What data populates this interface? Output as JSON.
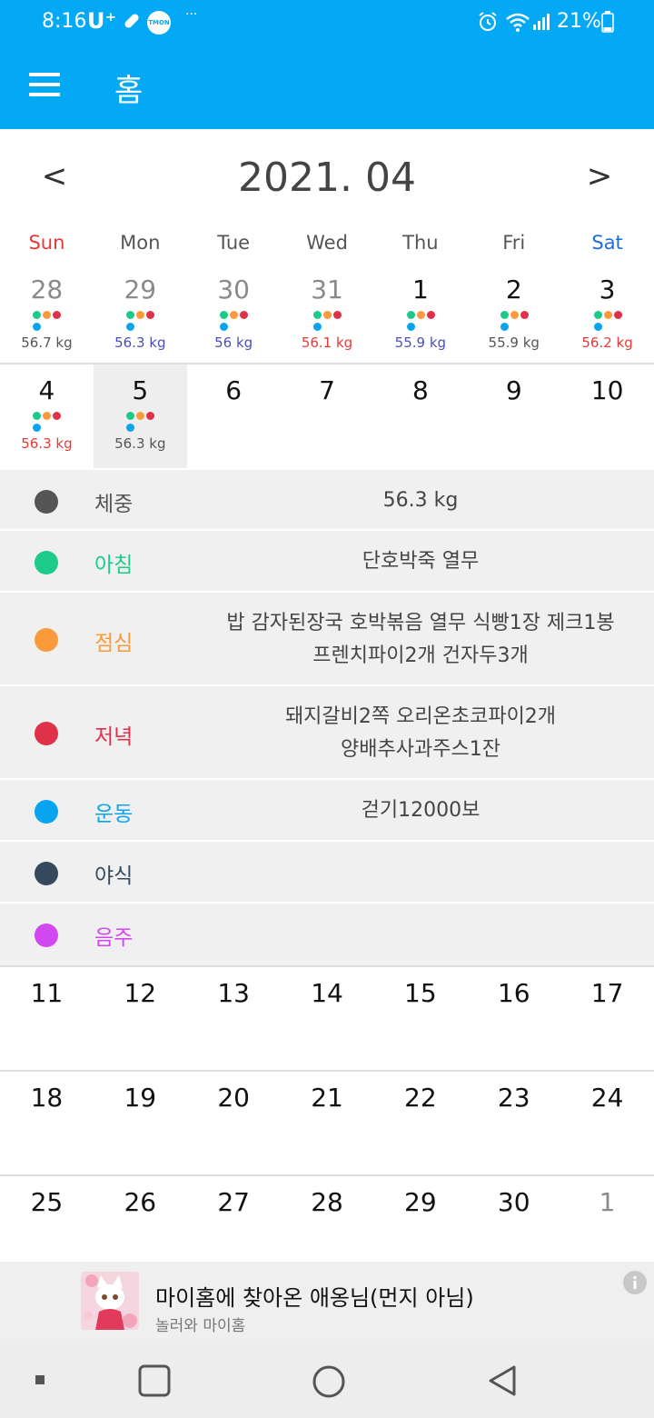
{
  "status_bar": {
    "time": "8:16",
    "carrier": "U⁺",
    "app_badge": "TMON",
    "overflow": "···",
    "battery": "21%",
    "icons": [
      "pill-icon",
      "tmon-icon",
      "alarm-icon",
      "wifi-icon",
      "signal-icon",
      "battery-icon"
    ]
  },
  "app_bar": {
    "title": "홈",
    "menu_icon": "menu-icon",
    "color": "#03a9f4"
  },
  "calendar": {
    "month_title": "2021. 04",
    "prev": "<",
    "next": ">",
    "weekdays": [
      "Sun",
      "Mon",
      "Tue",
      "Wed",
      "Thu",
      "Fri",
      "Sat"
    ],
    "weeks": [
      [
        {
          "day": "28",
          "weight": "56.7 kg",
          "muted": true
        },
        {
          "day": "29",
          "weight": "56.3 kg",
          "muted": true
        },
        {
          "day": "30",
          "weight": "56 kg",
          "muted": true
        },
        {
          "day": "31",
          "weight": "56.1 kg",
          "muted": true
        },
        {
          "day": "1",
          "weight": "55.9 kg"
        },
        {
          "day": "2",
          "weight": "55.9 kg"
        },
        {
          "day": "3",
          "weight": "56.2 kg"
        }
      ],
      [
        {
          "day": "4",
          "weight": "56.3 kg"
        },
        {
          "day": "5",
          "weight": "56.3 kg",
          "selected": true
        },
        {
          "day": "6"
        },
        {
          "day": "7"
        },
        {
          "day": "8"
        },
        {
          "day": "9"
        },
        {
          "day": "10"
        }
      ],
      [
        {
          "day": "11"
        },
        {
          "day": "12"
        },
        {
          "day": "13"
        },
        {
          "day": "14"
        },
        {
          "day": "15"
        },
        {
          "day": "16"
        },
        {
          "day": "17"
        }
      ],
      [
        {
          "day": "18"
        },
        {
          "day": "19"
        },
        {
          "day": "20"
        },
        {
          "day": "21"
        },
        {
          "day": "22"
        },
        {
          "day": "23"
        },
        {
          "day": "24"
        }
      ],
      [
        {
          "day": "25"
        },
        {
          "day": "26"
        },
        {
          "day": "27"
        },
        {
          "day": "28"
        },
        {
          "day": "29"
        },
        {
          "day": "30"
        },
        {
          "day": "1",
          "muted": true
        }
      ]
    ],
    "weight_colors": {
      "up": "#e53935",
      "down": "#4a4fb7",
      "same": "#555555"
    },
    "dot_colors": [
      "#1ccb8a",
      "#fb9a3a",
      "#e0314b",
      "#09a4f0"
    ]
  },
  "detail": {
    "rows": [
      {
        "label": "체중",
        "value": [
          "56.3 kg"
        ],
        "color": "#555555",
        "text_color": "#555555"
      },
      {
        "label": "아침",
        "value": [
          "단호박죽 열무"
        ],
        "color": "#1ccb8a",
        "text_color": "#1ccb8a"
      },
      {
        "label": "점심",
        "value": [
          "밥 감자된장국 호박볶음 열무 식빵1장 제크1봉",
          "프렌치파이2개 건자두3개"
        ],
        "color": "#fb9a3a",
        "text_color": "#fb9a3a"
      },
      {
        "label": "저녁",
        "value": [
          "돼지갈비2쪽 오리온초코파이2개",
          "양배추사과주스1잔"
        ],
        "color": "#e0314b",
        "text_color": "#e0314b"
      },
      {
        "label": "운동",
        "value": [
          "걷기12000보"
        ],
        "color": "#09a4f0",
        "text_color": "#09a4f0"
      },
      {
        "label": "야식",
        "value": [],
        "color": "#34495e",
        "text_color": "#34495e"
      },
      {
        "label": "음주",
        "value": [],
        "color": "#d148f0",
        "text_color": "#d148f0"
      }
    ]
  },
  "ad": {
    "title": "마이홈에 찾아온 애옹님(먼지 아님)",
    "subtitle": "놀러와 마이홈"
  },
  "nav_bar": {
    "buttons": [
      "recent-apps-icon",
      "home-icon",
      "back-icon"
    ]
  }
}
